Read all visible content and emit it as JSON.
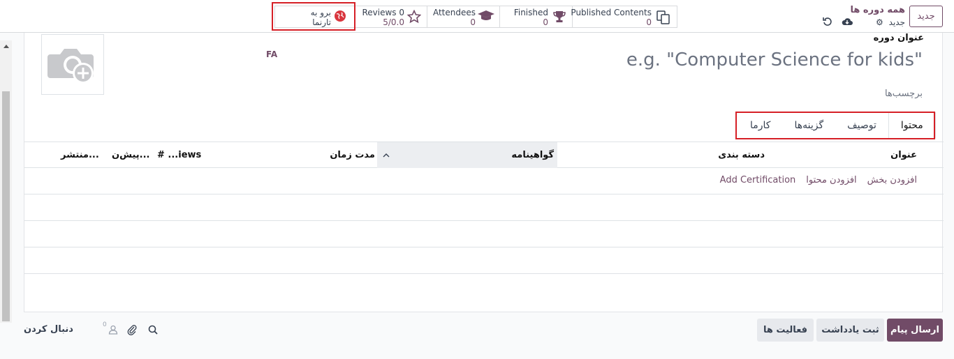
{
  "topbar": {
    "new_button": "جدید",
    "breadcrumb_title": "همه دوره ها",
    "breadcrumb_sub": "جدید"
  },
  "smart_buttons": {
    "website": {
      "line1": "برو به",
      "line2": "تارنما"
    },
    "reviews": {
      "label": "Reviews 0",
      "value": "5/0.0"
    },
    "attendees": {
      "label": "Attendees",
      "value": "0"
    },
    "finished": {
      "label": "Finished",
      "value": "0"
    },
    "published": {
      "label": "Published Contents",
      "value": "0"
    }
  },
  "form": {
    "field_label": "عنوان دوره",
    "course_name_placeholder": "e.g. \"Computer Science for kids\"",
    "lang": "FA",
    "tags_label": "برچسب‌ها"
  },
  "tabs": [
    "محتوا",
    "توصیف",
    "گزینه‌ها",
    "کارما"
  ],
  "table": {
    "columns": [
      "عنوان",
      "دسته بندی",
      "گواهینامه",
      "مدت زمان",
      "# ...iews",
      "پیش‌ن...",
      "منتشر..."
    ],
    "add_links": [
      "افزودن بخش",
      "افزودن محتوا",
      "Add Certification"
    ]
  },
  "chatter": {
    "send_message": "ارسال پیام",
    "log_note": "ثبت یادداشت",
    "activities": "فعالیت ها",
    "follow": "دنبال کردن",
    "followers_count": "0"
  },
  "colors": {
    "brand": "#714b67",
    "highlight": "#d61f26"
  }
}
